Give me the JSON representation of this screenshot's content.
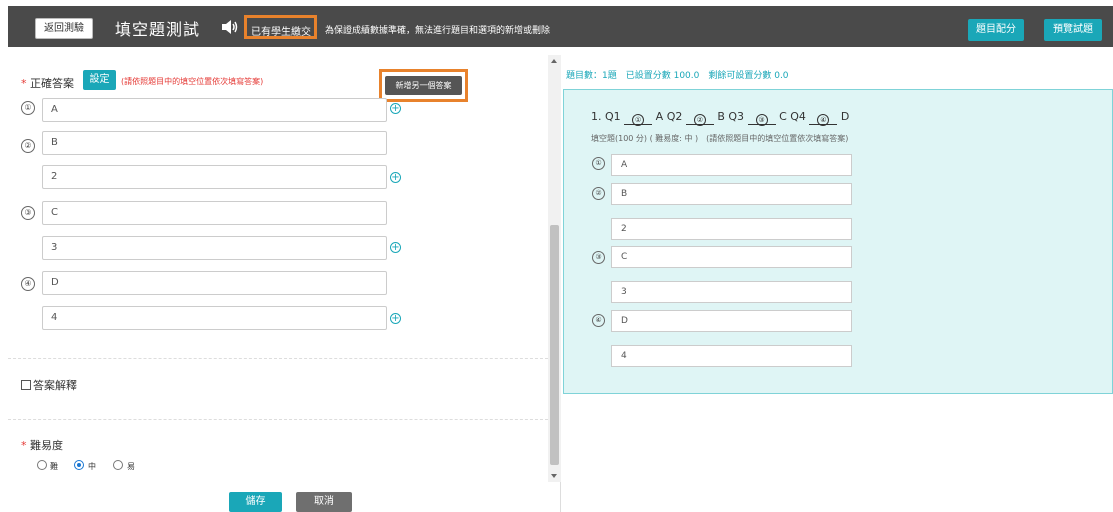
{
  "header": {
    "back_label": "返回測驗",
    "title": "填空題測試",
    "submitted_badge": "已有學生繳交",
    "warning": "為保證成績數據準確，無法進行題目和選項的新增或刪除",
    "score_button": "題目配分",
    "preview_button": "預覽試題"
  },
  "editor": {
    "correct_answer_label": "正確答案",
    "set_button": "設定",
    "hint": "(請依照題目中的填空位置依次填寫答案)",
    "add_answer_tooltip": "新增另一個答案",
    "blanks": [
      {
        "num": "①",
        "answers": [
          "A"
        ]
      },
      {
        "num": "②",
        "answers": [
          "B",
          "2"
        ]
      },
      {
        "num": "③",
        "answers": [
          "C",
          "3"
        ]
      },
      {
        "num": "④",
        "answers": [
          "D",
          "4"
        ]
      }
    ],
    "explanation_label": "答案解釋",
    "difficulty_label": "難易度",
    "difficulty_options": [
      "難",
      "中",
      "易"
    ],
    "difficulty_selected": "中",
    "save_label": "儲存",
    "cancel_label": "取消"
  },
  "preview": {
    "stats": "題目數：1題　已設置分數 100.0　剩餘可設置分數 0.0",
    "question": {
      "number": "1.",
      "parts": [
        "Q1",
        "A Q2",
        "B Q3",
        "C Q4",
        "D"
      ],
      "blank_nums": [
        "①",
        "②",
        "③",
        "④"
      ],
      "meta": "填空題(100 分) ( 難易度: 中 )　(請依照題目中的填空位置依次填寫答案)"
    },
    "blanks": [
      {
        "num": "①",
        "answers": [
          "A"
        ]
      },
      {
        "num": "②",
        "answers": [
          "B",
          "2"
        ]
      },
      {
        "num": "③",
        "answers": [
          "C",
          "3"
        ]
      },
      {
        "num": "④",
        "answers": [
          "D",
          "4"
        ]
      }
    ]
  },
  "colors": {
    "accent": "#1aa7b8",
    "header_bg": "#4a4a4a",
    "highlight": "#e8822c",
    "preview_bg": "#dff5f5"
  }
}
